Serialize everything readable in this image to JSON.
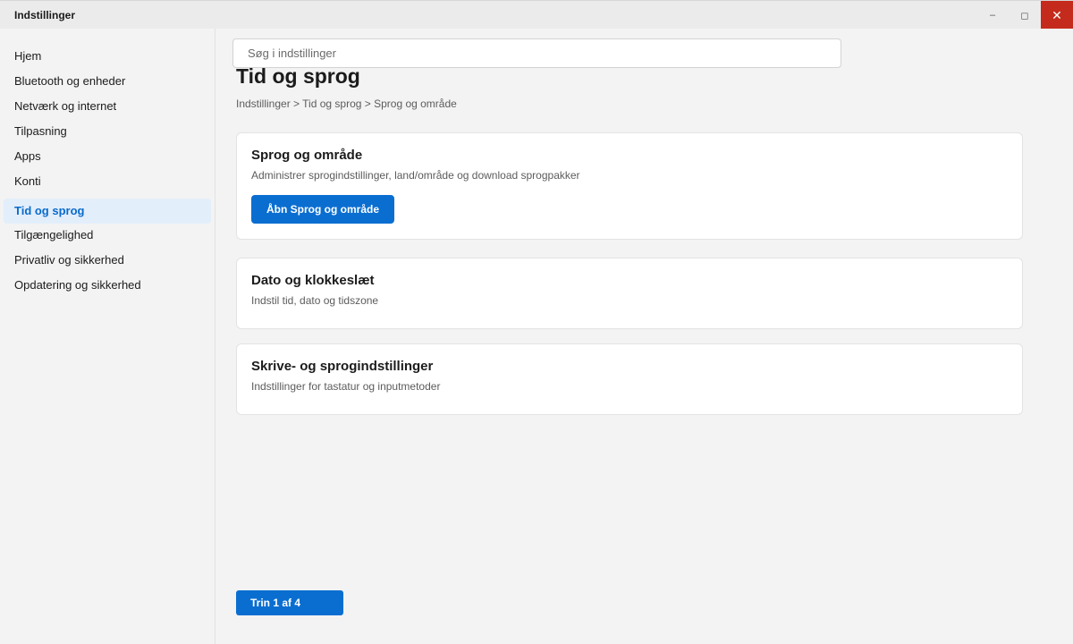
{
  "window": {
    "title": "Indstillinger",
    "minimize_glyph": "–",
    "maximize_glyph": "◻",
    "close_glyph": "✕"
  },
  "sidebar": {
    "items": [
      {
        "label": "Hjem"
      },
      {
        "label": "Bluetooth og enheder"
      },
      {
        "label": "Netværk og internet"
      },
      {
        "label": "Tilpasning"
      },
      {
        "label": "Apps"
      },
      {
        "label": "Konti"
      },
      {
        "label": "Tid og sprog",
        "active": true
      },
      {
        "label": "Tilgængelighed"
      },
      {
        "label": "Privatliv og sikkerhed"
      },
      {
        "label": "Opdatering og sikkerhed"
      }
    ]
  },
  "search": {
    "placeholder": "Søg i indstillinger",
    "value": ""
  },
  "main": {
    "title": "Tid og sprog",
    "breadcrumb": "Indstillinger > Tid og sprog > Sprog og område",
    "cards": [
      {
        "title": "Sprog og område",
        "description": "Administrer sprogindstillinger, land/område og download sprogpakker",
        "button_label": "Åbn Sprog og område"
      },
      {
        "title": "Dato og klokkeslæt",
        "description": "Indstil tid, dato og tidszone"
      },
      {
        "title": "Skrive- og sprogindstillinger",
        "description": "Indstillinger for tastatur og inputmetoder"
      }
    ],
    "step_label": "Trin 1 af 4"
  },
  "colors": {
    "accent": "#0a6ed1",
    "active_nav_bg": "#e3eefb",
    "close_button": "#c42b1c"
  }
}
